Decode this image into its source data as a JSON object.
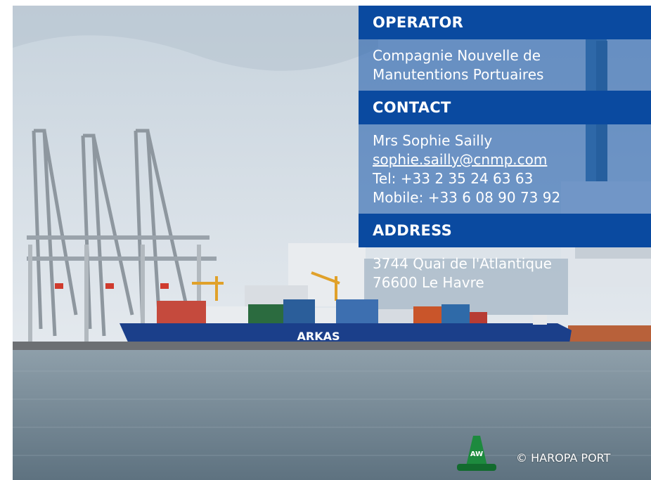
{
  "operator": {
    "heading": "OPERATOR",
    "line1": "Compagnie Nouvelle de",
    "line2": "Manutentions Portuaires"
  },
  "contact": {
    "heading": "CONTACT",
    "name": "Mrs Sophie Sailly",
    "email": "sophie.sailly@cnmp.com",
    "tel": "Tel: +33 2 35 24 63 63",
    "mobile": "Mobile: +33 6 08 90 73 92"
  },
  "address": {
    "heading": "ADDRESS",
    "line1": "3744 Quai de l'Atlantique",
    "line2": "76600 Le Havre"
  },
  "photo": {
    "ship_name": "ARKAS",
    "buoy_mark": "AW",
    "credit": "© HAROPA PORT"
  },
  "colors": {
    "panel_header": "#0a4aa0",
    "panel_body": "#1656aa",
    "hull": "#1b3f8a",
    "water": "#6f8492"
  }
}
